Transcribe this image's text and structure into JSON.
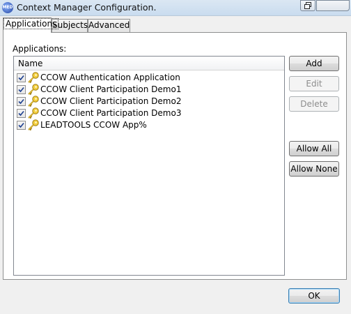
{
  "window": {
    "title": "Context Manager Configuration.",
    "icon": "app-globe-icon"
  },
  "tabs": [
    {
      "label": "Applications",
      "active": true
    },
    {
      "label": "Subjects",
      "active": false
    },
    {
      "label": "Advanced",
      "active": false
    }
  ],
  "panel": {
    "list_label": "Applications:",
    "column_header": "Name",
    "rows": [
      {
        "label": "CCOW Authentication Application",
        "checked": true,
        "icon": "key-icon"
      },
      {
        "label": "CCOW Client Participation Demo1",
        "checked": true,
        "icon": "key-icon"
      },
      {
        "label": "CCOW Client Participation Demo2",
        "checked": true,
        "icon": "key-icon"
      },
      {
        "label": "CCOW Client Participation Demo3",
        "checked": true,
        "icon": "key-icon"
      },
      {
        "label": "LEADTOOLS CCOW App%",
        "checked": true,
        "icon": "key-icon"
      }
    ]
  },
  "buttons": {
    "add": "Add",
    "edit": "Edit",
    "delete": "Delete",
    "allow_all": "Allow All",
    "allow_none": "Allow None",
    "ok": "OK"
  }
}
